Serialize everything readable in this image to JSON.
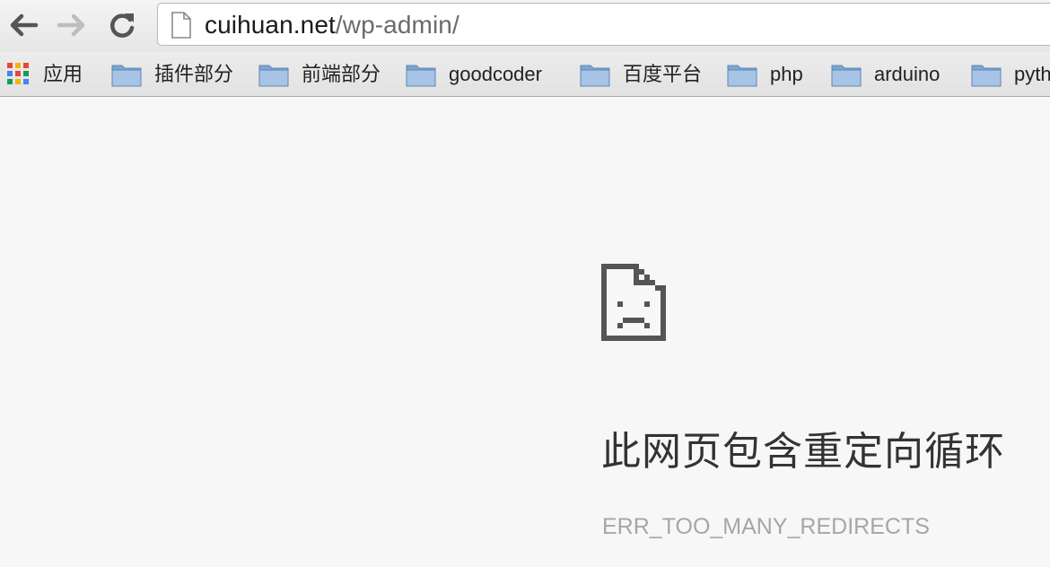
{
  "toolbar": {
    "back_icon": "arrow-left-icon",
    "forward_icon": "arrow-right-icon",
    "reload_icon": "reload-icon",
    "url_host": "cuihuan.net",
    "url_path": "/wp-admin/",
    "page_icon": "blank-page-icon"
  },
  "bookmarks": {
    "apps_label": "应用",
    "items": [
      {
        "label": "插件部分",
        "icon": "folder-icon"
      },
      {
        "label": "前端部分",
        "icon": "folder-icon"
      },
      {
        "label": "goodcoder",
        "icon": "folder-icon"
      },
      {
        "label": "百度平台",
        "icon": "folder-icon"
      },
      {
        "label": "php",
        "icon": "folder-icon"
      },
      {
        "label": "arduino",
        "icon": "folder-icon"
      },
      {
        "label": "pyth",
        "icon": "folder-icon"
      }
    ]
  },
  "error": {
    "icon": "sad-document-icon",
    "heading": "此网页包含重定向循环",
    "code": "ERR_TOO_MANY_REDIRECTS"
  },
  "colors": {
    "page_background": "#f7f7f7",
    "heading_text": "#333333",
    "error_code_text": "#a6a6a6",
    "folder_blue": "#8fb3d9"
  }
}
